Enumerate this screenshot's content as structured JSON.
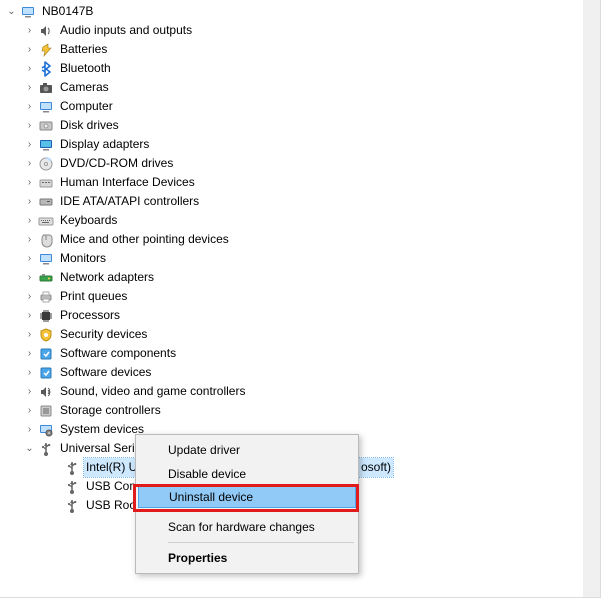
{
  "root": {
    "name": "NB0147B",
    "expanded": true
  },
  "categories": [
    {
      "id": "audio",
      "label": "Audio inputs and outputs",
      "icon": "speaker",
      "expanded": false
    },
    {
      "id": "batt",
      "label": "Batteries",
      "icon": "battery",
      "expanded": false
    },
    {
      "id": "bt",
      "label": "Bluetooth",
      "icon": "bluetooth",
      "expanded": false
    },
    {
      "id": "cam",
      "label": "Cameras",
      "icon": "camera",
      "expanded": false
    },
    {
      "id": "comp",
      "label": "Computer",
      "icon": "monitor",
      "expanded": false
    },
    {
      "id": "disk",
      "label": "Disk drives",
      "icon": "disk",
      "expanded": false
    },
    {
      "id": "disp",
      "label": "Display adapters",
      "icon": "monitor-blue",
      "expanded": false
    },
    {
      "id": "dvd",
      "label": "DVD/CD-ROM drives",
      "icon": "cd",
      "expanded": false
    },
    {
      "id": "hid",
      "label": "Human Interface Devices",
      "icon": "hid",
      "expanded": false
    },
    {
      "id": "ide",
      "label": "IDE ATA/ATAPI controllers",
      "icon": "drive",
      "expanded": false
    },
    {
      "id": "kb",
      "label": "Keyboards",
      "icon": "keyboard",
      "expanded": false
    },
    {
      "id": "mouse",
      "label": "Mice and other pointing devices",
      "icon": "mouse",
      "expanded": false
    },
    {
      "id": "mon",
      "label": "Monitors",
      "icon": "monitor",
      "expanded": false
    },
    {
      "id": "net",
      "label": "Network adapters",
      "icon": "network",
      "expanded": false
    },
    {
      "id": "print",
      "label": "Print queues",
      "icon": "printer",
      "expanded": false
    },
    {
      "id": "cpu",
      "label": "Processors",
      "icon": "chip",
      "expanded": false
    },
    {
      "id": "sec",
      "label": "Security devices",
      "icon": "shield",
      "expanded": false
    },
    {
      "id": "swc",
      "label": "Software components",
      "icon": "software",
      "expanded": false
    },
    {
      "id": "swd",
      "label": "Software devices",
      "icon": "software",
      "expanded": false
    },
    {
      "id": "snd",
      "label": "Sound, video and game controllers",
      "icon": "sound",
      "expanded": false
    },
    {
      "id": "stor",
      "label": "Storage controllers",
      "icon": "storage",
      "expanded": false
    },
    {
      "id": "sys",
      "label": "System devices",
      "icon": "system",
      "expanded": false
    },
    {
      "id": "usb",
      "label": "Universal Serial Bus controllers",
      "icon": "usb",
      "expanded": true
    }
  ],
  "usb_children": [
    {
      "label": "Intel(R) U",
      "suffix": "osoft)",
      "selected": true
    },
    {
      "label": "USB Com",
      "selected": false
    },
    {
      "label": "USB Root",
      "selected": false
    }
  ],
  "context_menu": {
    "items": [
      {
        "label": "Update driver",
        "sep_after": false,
        "highlighted": false,
        "bold": false
      },
      {
        "label": "Disable device",
        "sep_after": false,
        "highlighted": false,
        "bold": false
      },
      {
        "label": "Uninstall device",
        "sep_after": true,
        "highlighted": true,
        "bold": false
      },
      {
        "label": "Scan for hardware changes",
        "sep_after": true,
        "highlighted": false,
        "bold": false
      },
      {
        "label": "Properties",
        "sep_after": false,
        "highlighted": false,
        "bold": true
      }
    ]
  }
}
